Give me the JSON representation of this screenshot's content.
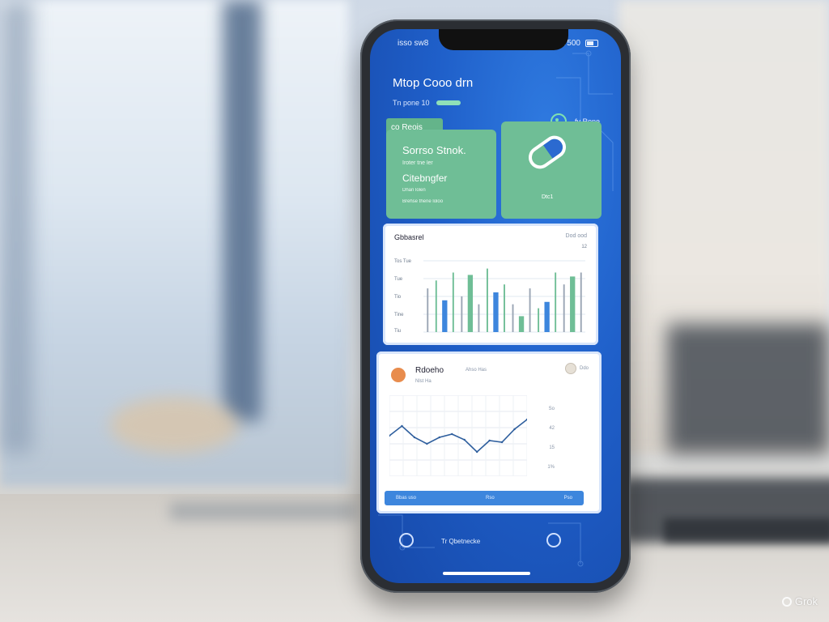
{
  "status_bar": {
    "left_text": "isso sw8",
    "right_text": "A 500"
  },
  "header": {
    "title": "Mtop Cooo drn",
    "subtitle": "Tn pone 10"
  },
  "top_right": {
    "label": "fy Rone"
  },
  "tag": {
    "label": "co Reois"
  },
  "stats_card": {
    "title": "Sorrso Stnok.",
    "line1": "Iroter tne ler",
    "subtitle": "Citebngfer",
    "line2": "Dhan lolen",
    "line3": "Brehse thene loloo"
  },
  "pill_card": {
    "label": "Dtc1"
  },
  "bar_panel": {
    "title": "Gbbasrel",
    "header_right": "Dod ood",
    "y_labels": [
      "Tos Tue",
      "Tue",
      "Tio",
      "Tine",
      "Tiu"
    ],
    "right_value": "12",
    "chart_data": {
      "type": "bar",
      "values": [
        55,
        65,
        40,
        75,
        45,
        72,
        35,
        80,
        50,
        60,
        35,
        20,
        55,
        30,
        38,
        75,
        60,
        70,
        75
      ],
      "ylim": [
        0,
        100
      ]
    }
  },
  "line_panel": {
    "title": "Rdoeho",
    "subtitle": "Nlst Ha",
    "header_mid": "Ahso Has",
    "corner": "Ddo",
    "right_labels": [
      "So",
      "42",
      "15",
      "1%"
    ],
    "footer_left": "Bbas uso",
    "footer_mid": "Rso",
    "footer_right": "Pso",
    "chart_data": {
      "type": "line",
      "values": [
        50,
        62,
        48,
        40,
        48,
        52,
        45,
        30,
        44,
        42,
        58,
        70
      ],
      "ylim": [
        0,
        100
      ]
    }
  },
  "bottom_bar": {
    "label": "Tr Qbetnecke"
  },
  "watermark": {
    "text": "Grok"
  },
  "colors": {
    "screen": "#1f5fc9",
    "green_card": "#6fbe96",
    "bar_blue": "#3d86dd",
    "bar_green": "#6fbe96"
  }
}
